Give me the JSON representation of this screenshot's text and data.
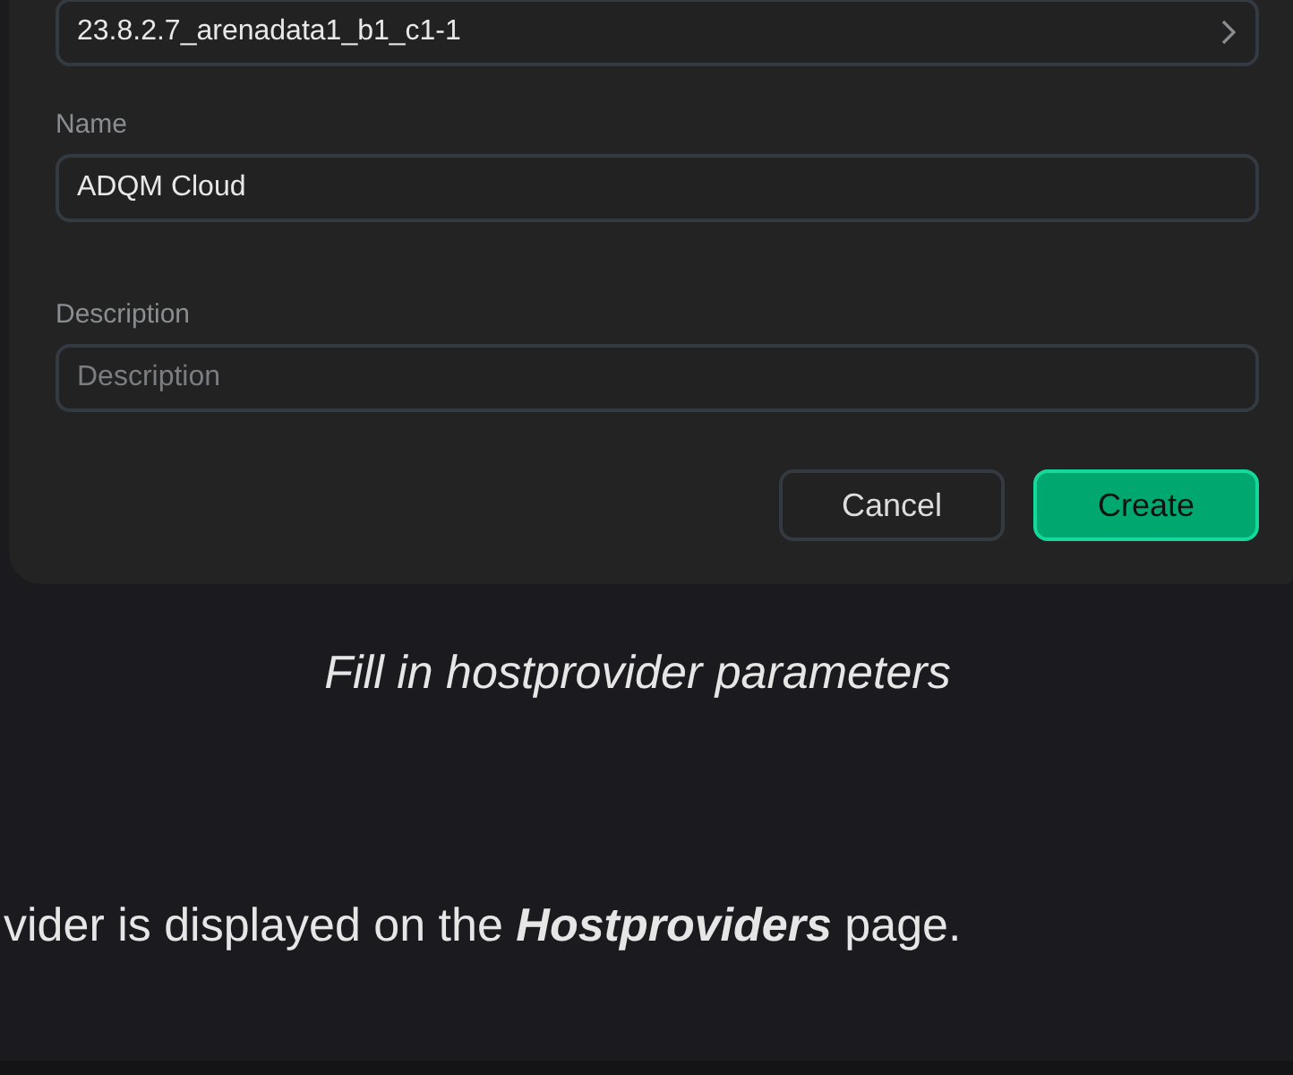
{
  "selector": {
    "value": "23.8.2.7_arenadata1_b1_c1-1"
  },
  "fields": [
    {
      "label": "Name",
      "value": "ADQM Cloud"
    },
    {
      "label": "Description",
      "placeholder": "Description"
    }
  ],
  "buttons": [
    {
      "label": "Cancel",
      "kind": "secondary"
    },
    {
      "label": "Create",
      "kind": "primary"
    }
  ],
  "caption": "Fill in hostprovider parameters",
  "body_text": "vider is displayed on the **Hostproviders** page."
}
